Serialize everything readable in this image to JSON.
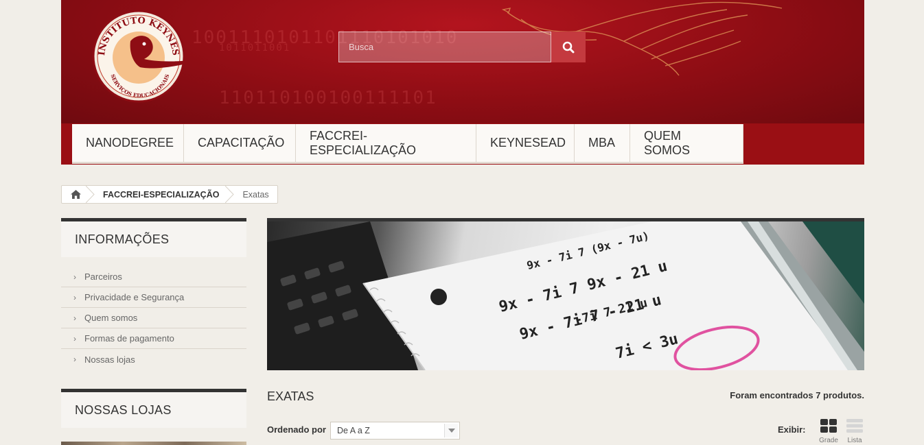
{
  "header": {
    "logo_text_top": "INSTITUTO KEYNES",
    "logo_text_bottom": "SERVIÇOS EDUCACIONAIS",
    "search_placeholder": "Busca",
    "search_icon": "search-icon",
    "colors": {
      "header": "#9a0f14",
      "search_button": "#c43a3f"
    }
  },
  "nav": {
    "items": [
      {
        "label": "NANODEGREE"
      },
      {
        "label": "CAPACITAÇÃO"
      },
      {
        "label": "FACCREI-ESPECIALIZAÇÃO"
      },
      {
        "label": "KEYNESEAD"
      },
      {
        "label": "MBA"
      },
      {
        "label": "QUEM SOMOS"
      }
    ]
  },
  "breadcrumb": {
    "home_icon": "home-icon",
    "items": [
      "FACCREI-ESPECIALIZAÇÃO",
      "Exatas"
    ]
  },
  "sidebar": {
    "info_title": "INFORMAÇÕES",
    "info_items": [
      "Parceiros",
      "Privacidade e Segurança",
      "Quem somos",
      "Formas de pagamento",
      "Nossas lojas"
    ],
    "stores_title": "NOSSAS LOJAS"
  },
  "category": {
    "title": "EXATAS",
    "count_text": "Foram encontrados 7 produtos.",
    "sort_label": "Ordenado por",
    "sort_value": "De A a Z",
    "view_label": "Exibir:",
    "view_grid": "Grade",
    "view_list": "Lista"
  }
}
